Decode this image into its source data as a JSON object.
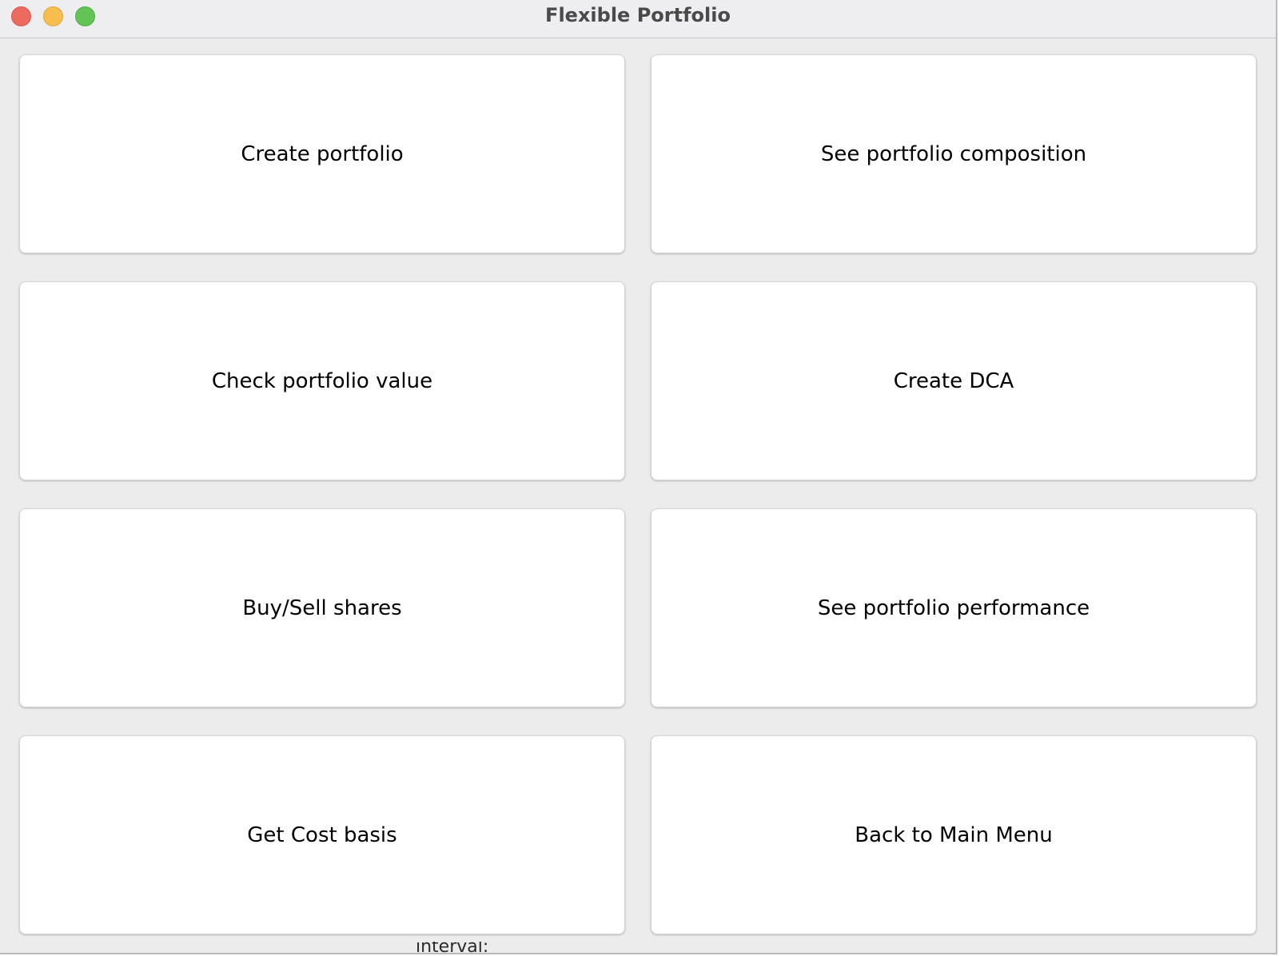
{
  "window": {
    "title": "Flexible Portfolio"
  },
  "titlebar": {
    "controls": [
      {
        "name": "close-icon",
        "color": "#ed6a5e"
      },
      {
        "name": "minimize-icon",
        "color": "#f5be4f"
      },
      {
        "name": "zoom-icon",
        "color": "#61c454"
      }
    ]
  },
  "menu": {
    "create_portfolio": "Create portfolio",
    "see_composition": "See portfolio composition",
    "check_value": "Check portfolio value",
    "create_dca": "Create DCA",
    "buy_sell": "Buy/Sell shares",
    "see_performance": "See portfolio performance",
    "cost_basis": "Get Cost basis",
    "back_main": "Back to Main Menu"
  },
  "background_window": {
    "text": "interval:"
  },
  "colors": {
    "window_bg": "#ececec",
    "button_bg": "#ffffff",
    "text": "#000000"
  }
}
